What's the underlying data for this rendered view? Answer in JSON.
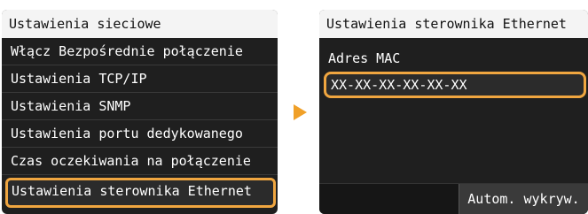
{
  "left_screen": {
    "title": "Ustawienia sieciowe",
    "items": [
      {
        "label": "Włącz Bezpośrednie połączenie",
        "selected": false
      },
      {
        "label": "Ustawienia TCP/IP",
        "selected": false
      },
      {
        "label": "Ustawienia SNMP",
        "selected": false
      },
      {
        "label": "Ustawienia portu dedykowanego",
        "selected": false
      },
      {
        "label": "Czas oczekiwania na połączenie",
        "selected": false
      },
      {
        "label": "Ustawienia sterownika Ethernet",
        "selected": true
      }
    ]
  },
  "arrow_icon": "right-arrow-icon",
  "right_screen": {
    "title": "Ustawienia sterownika Ethernet",
    "mac_label": "Adres MAC",
    "mac_value": "XX-XX-XX-XX-XX-XX",
    "auto_detect_button": "Autom. wykryw."
  },
  "colors": {
    "highlight": "#f0a640",
    "arrow": "#f0a028",
    "screen_background": "#1f1f1f",
    "title_background": "#f4f4f4"
  }
}
